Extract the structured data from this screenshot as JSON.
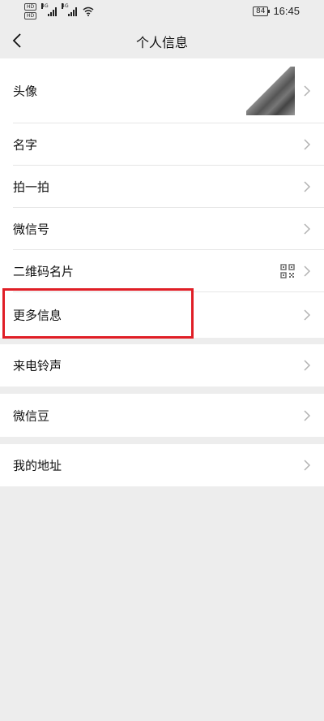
{
  "status_bar": {
    "sim1": "HD",
    "sim2": "HD",
    "net1": "4G",
    "net2": "4G",
    "battery": "84",
    "time": "16:45"
  },
  "nav": {
    "title": "个人信息"
  },
  "rows": {
    "avatar": "头像",
    "name": "名字",
    "pat": "拍一拍",
    "wechat_id": "微信号",
    "qr_card": "二维码名片",
    "more_info": "更多信息",
    "ringtone": "来电铃声",
    "wechat_beans": "微信豆",
    "address": "我的地址"
  },
  "colors": {
    "background": "#ededed",
    "highlight": "#e01e26"
  }
}
